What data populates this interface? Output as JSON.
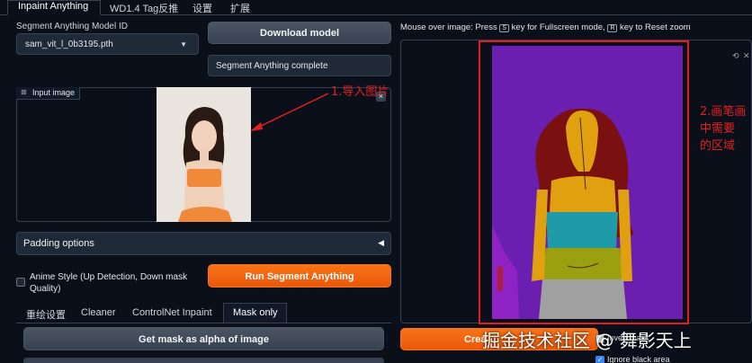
{
  "tabs": [
    "Inpaint Anything",
    "WD1.4 Tag反推",
    "设置",
    "扩展"
  ],
  "model": {
    "label": "Segment Anything Model ID",
    "selected": "sam_vit_l_0b3195.pth"
  },
  "download_button": "Download model",
  "status_text": "Segment Anything complete",
  "input_image_label": "Input image",
  "annotation1": "1.导入图片",
  "padding_options": "Padding options",
  "anime_style": "Anime Style (Up Detection, Down mask Quality)",
  "run_button": "Run Segment Anything",
  "sub_tabs": [
    "重绘设置",
    "Cleaner",
    "ControlNet Inpaint",
    "Mask only"
  ],
  "get_mask_button": "Get mask as alpha of image",
  "right_instructions": {
    "pre": "Mouse over image: Press",
    "key1": "S",
    "mid": "key for Fullscreen mode,",
    "key2": "R",
    "post": "key to Reset zoom"
  },
  "annotation2": [
    "2.画笔画",
    "中需要",
    "的区域"
  ],
  "create_button": "Crea",
  "invert_mask": "Invert mask",
  "ignore_black": "Ignore black area",
  "watermark": "掘金技术社区 @ 舞影天上",
  "colors": {
    "accent_orange": "#f97316",
    "background": "#0b0f19",
    "annotation_red": "#e02020",
    "seg_purple": "#6b1fb0",
    "seg_orange": "#e0a010",
    "seg_teal": "#1e9aa8",
    "seg_olive": "#9aa010",
    "seg_gray": "#a0a0a0",
    "seg_hair": "#7a1010"
  }
}
